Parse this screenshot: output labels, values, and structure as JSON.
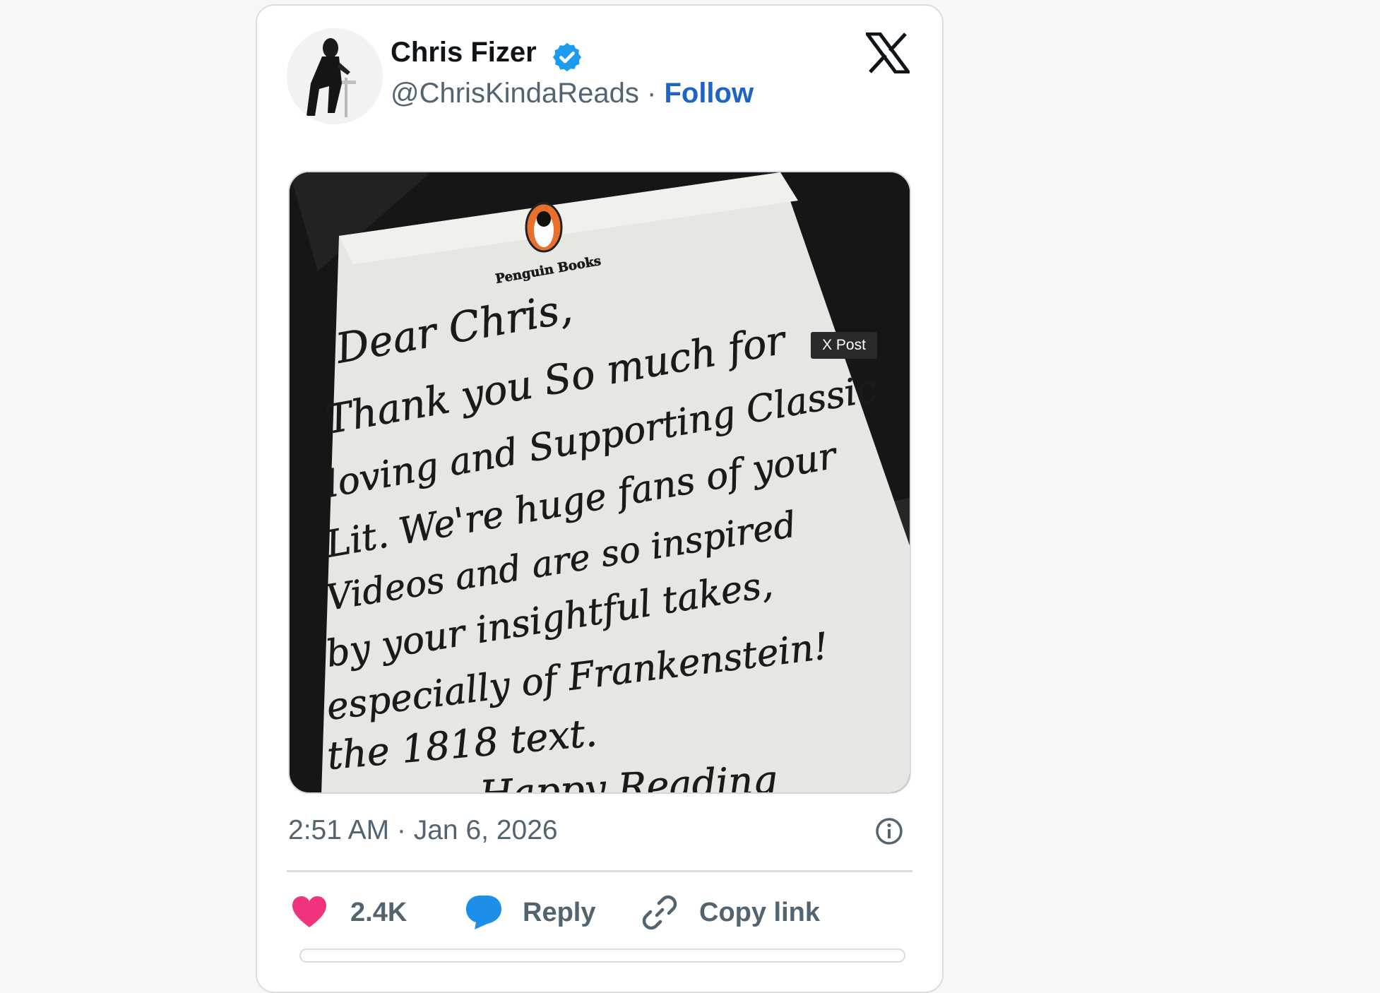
{
  "author": {
    "name": "Chris Fizer",
    "handle": "@ChrisKindaReads",
    "separator": "·",
    "follow_label": "Follow"
  },
  "media": {
    "badge": "X Post",
    "letter": {
      "logo_text": "Penguin Books",
      "lines": [
        "Dear Chris,",
        "Thank you So much for",
        "loving and Supporting Classic",
        "Lit. We're huge fans of your",
        "Videos and are so inspired",
        "by your insightful takes,",
        "especially of Frankenstein!",
        "the 1818 text.",
        "Happy Reading"
      ]
    }
  },
  "timestamp": "2:51 AM · Jan 6, 2026",
  "actions": {
    "likes": "2.4K",
    "reply_label": "Reply",
    "copy_label": "Copy link"
  },
  "colors": {
    "verified": "#1d9bf0",
    "follow": "#1d64c7",
    "like": "#f0327f",
    "reply": "#1d8fe8",
    "muted": "#536471"
  },
  "icons": [
    "verified-badge-icon",
    "x-logo-icon",
    "info-icon",
    "heart-icon",
    "reply-bubble-icon",
    "link-icon"
  ]
}
